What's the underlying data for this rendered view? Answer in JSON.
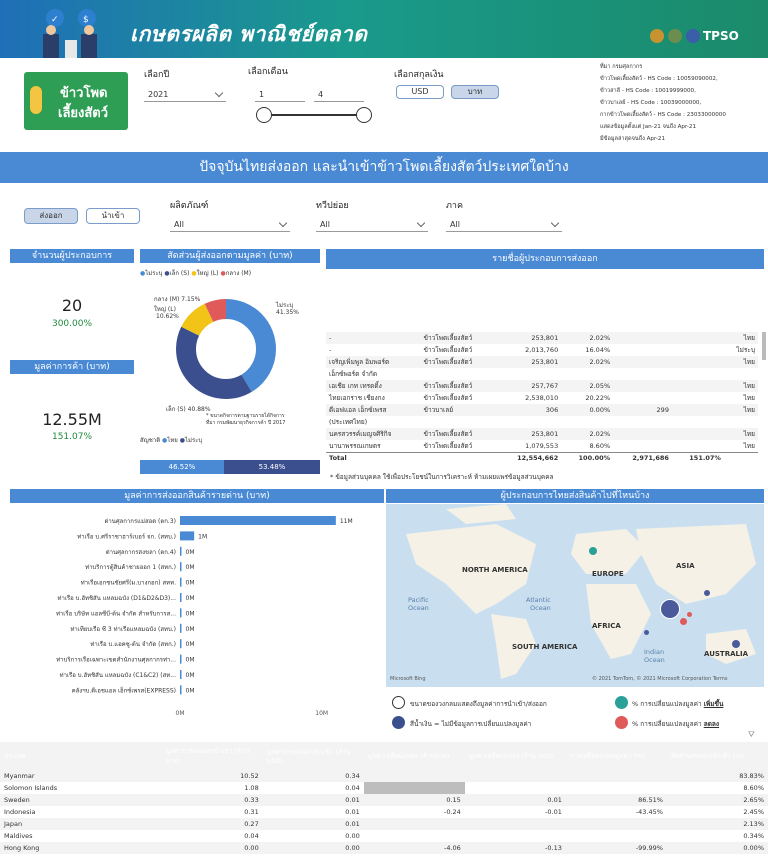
{
  "header": {
    "title": "เกษตรผลิต พาณิชย์ตลาด",
    "logo_text": "TPSO"
  },
  "product_badge": {
    "line1": "ข้าวโพด",
    "line2": "เลี้ยงสัตว์"
  },
  "filters": {
    "year_label": "เลือกปี",
    "year_value": "2021",
    "month_label": "เลือกเดือน",
    "month_from": "1",
    "month_to": "4",
    "currency_label": "เลือกสกุลเงิน",
    "currency_usd": "USD",
    "currency_thb": "บาท"
  },
  "source_info": [
    "ที่มา กรมศุลกากร",
    "ข้าวโพดเลี้ยงสัตว์ - HS Code : 10059090002,",
    "ข้าวสาลี - HS Code : 10019999000,",
    "ข้าวบาเลย์ - HS Code : 10039000000,",
    "กากข้าวโพดเลี้ยงสัตว์ - HS Code : 23033000000",
    "แสดงข้อมูลตั้งแต่ Jan-21 จนถึง Apr-21",
    "มีข้อมูลล่าสุดจนถึง Apr-21"
  ],
  "section_title": "ปัจจุบันไทยส่งออก และนำเข้าข้าวโพดเลี้ยงสัตว์ประเทศใดบ้าง",
  "toggle": {
    "export": "ส่งออก",
    "import": "นำเข้า"
  },
  "slicers": {
    "product_label": "ผลิตภัณฑ์",
    "product_value": "All",
    "continent_label": "ทวีปย่อย",
    "continent_value": "All",
    "region_label": "ภาค",
    "region_value": "All"
  },
  "cards": {
    "operators_title": "จำนวนผู้ประกอบการ",
    "operators_value": "20",
    "operators_change": "300.00%",
    "trade_title": "มูลค่าการค้า (บาท)",
    "trade_value": "12.55M",
    "trade_change": "151.07%"
  },
  "donut": {
    "title": "สัดส่วนผู้ส่งออกตามมูลค่า (บาท)",
    "legend": [
      "ไม่ระบุ",
      "เล็ก (S)",
      "ใหญ่ (L)",
      "กลาง (M)"
    ],
    "label_m": "กลาง (M) 7.15%",
    "label_l1": "ใหญ่ (L)",
    "label_l2": "10.62%",
    "label_na1": "ไม่ระบุ",
    "label_na2": "41.35%",
    "label_s": "เล็ก (S) 40.88%",
    "note1": "* ขนาดกิจการตามฐานรายได้กิจการ",
    "note2": "ที่มา กรมพัฒนาธุรกิจการค้า ปี 2017",
    "nat_label": "สัญชาติ",
    "nat_thai": "ไทย",
    "nat_na": "ไม่ระบุ",
    "bar_left": "46.52%",
    "bar_right": "53.48%"
  },
  "list_title": "รายชื่อผู้ประกอบการส่งออก",
  "operators": [
    [
      "-",
      "ข้าวโพดเลี้ยงสัตว์",
      "253,801",
      "2.02%",
      "",
      "",
      "ไทย"
    ],
    [
      "-",
      "ข้าวโพดเลี้ยงสัตว์",
      "2,013,760",
      "16.04%",
      "",
      "",
      "ไม่ระบุ"
    ],
    [
      "เจริญเพิ่มพูล อิมพอร์ต",
      "ข้าวโพดเลี้ยงสัตว์",
      "253,801",
      "2.02%",
      "",
      "",
      "ไทย"
    ],
    [
      "เอ็กซ์พอร์ต จำกัด",
      "",
      "",
      "",
      "",
      "",
      ""
    ],
    [
      "เอเชีย เกท เทรดดิ้ง",
      "ข้าวโพดเลี้ยงสัตว์",
      "257,767",
      "2.05%",
      "",
      "",
      "ไทย"
    ],
    [
      "ไทยเอกราช เชียงกง",
      "ข้าวโพดเลี้ยงสัตว์",
      "2,538,010",
      "20.22%",
      "",
      "",
      "ไทย"
    ],
    [
      "ดีเอฟแอล เอ็กซ์เพรส",
      "ข้าวบาเลย์",
      "306",
      "0.00%",
      "299",
      "",
      "ไทย"
    ],
    [
      "(ประเทศไทย)",
      "",
      "",
      "",
      "",
      "",
      ""
    ],
    [
      "นครสวรรค์เมญจศิริกิจ",
      "ข้าวโพดเลี้ยงสัตว์",
      "253,801",
      "2.02%",
      "",
      "",
      "ไทย"
    ],
    [
      "นานาพรรณเกษตร",
      "ข้าวโพดเลี้ยงสัตว์",
      "1,079,553",
      "8.60%",
      "",
      "",
      "ไทย"
    ]
  ],
  "operators_total": [
    "Total",
    "",
    "12,554,662",
    "100.00%",
    "2,971,686",
    "151.07%",
    ""
  ],
  "operators_note": "* ข้อมูลส่วนบุคคล ใช้เพื่อประโยชน์ในการวิเคราะห์ ห้ามเผยแพร่ข้อมูลส่วนบุคคล",
  "port_chart_title": "มูลค่าการส่งออกสินค้ารายด่าน (บาท)",
  "chart_data": {
    "type": "bar",
    "categories": [
      "ด่านศุลกากรแม่สอด (ตก.3)",
      "ท่าเรือ บ.ศรีราชาฮาร์เบอร์ จก. (สทบ.)",
      "ด่านศุลกากรสงขลา (ตก.4)",
      "ท่าบริการตู้สินค้าชายออก 1 (สทก.)",
      "ท่าเรือเอกชนชัยศรี(ม.บางกอก) สทท.",
      "ท่าเรือ บ.ฮัทชิสัน แหลมฉบัง (D1&D2&D3)...",
      "ท่าเรือ บริษัท แอลซีบี-ต้น จำกัด สำหรับการส...",
      "ท่าเทียบเรือ ซี 3 ท่าเรือแหลมฉบัง (สทบ.)",
      "ท่าเรือ บ.แอคซู-ต้น จำกัด (สทก.)",
      "ท่าบริการเรือเฉพาะเขตสำนักงานศุลกากรท่า...",
      "ท่าเรือ บ.ฮัทชิสัน แหลมฉบัง (C1&C2) (สท...",
      "คลังฯบ.ดีเอชแอล เอ็กซ์เพรส(EXPRESS)"
    ],
    "values": [
      11,
      1,
      0,
      0,
      0,
      0,
      0,
      0,
      0,
      0,
      0,
      0
    ],
    "value_labels": [
      "11M",
      "1M",
      "0M",
      "0M",
      "0M",
      "0M",
      "0M",
      "0M",
      "0M",
      "0M",
      "0M",
      "0M"
    ],
    "x_ticks": [
      "0M",
      "10M"
    ],
    "xlim": [
      0,
      12
    ]
  },
  "map": {
    "title": "ผู้ประกอบการไทยส่งสินค้าไปที่ไหนบ้าง",
    "labels": {
      "na": "NORTH AMERICA",
      "eu": "EUROPE",
      "asia": "ASIA",
      "pac": "Pacific",
      "pac2": "Ocean",
      "atl": "Atlantic",
      "atl2": "Ocean",
      "af": "AFRICA",
      "sa": "SOUTH AMERICA",
      "ind": "Indian",
      "ind2": "Ocean",
      "au": "AUSTRALIA"
    },
    "brand": "Microsoft Bing",
    "copyright": "© 2021 TomTom, © 2021 Microsoft Corporation Terms"
  },
  "legend": {
    "size": "ขนาดของวงกลมแสดงถึงมูลค่าการนำเข้า/ส่งออก",
    "blue": "สีน้ำเงิน = ไม่มีข้อมูลการเปลี่ยนแปลงมูลค่า",
    "teal": "% การเปลี่ยนแปลงมูลค่า",
    "teal_b": "เพิ่มขึ้น",
    "red": "% การเปลี่ยนแปลงมูลค่า",
    "red_b": "ลดลง"
  },
  "country_table": {
    "headers": [
      "ประเทศ",
      "มูลค่าการส่งออก/นำเข้า (ล้านบาท)",
      "มูลค่าการส่งออก/นำเข้า (ล้าน USD)",
      "มูลค่าเปลี่ยนแปลง (ล้านบาท)",
      "มูลค่าเปลี่ยนแปลง (ล้าน USD)",
      "การเปลี่ยนแปลงมูลค่า (%)",
      "สัดส่วนส่งออก/นำเข้า (%)"
    ],
    "rows": [
      [
        "Myanmar",
        "10.52",
        "0.34",
        "",
        "",
        "",
        "83.83%"
      ],
      [
        "Solomon Islands",
        "1.08",
        "0.04",
        "",
        "",
        "",
        "8.60%"
      ],
      [
        "Sweden",
        "0.33",
        "0.01",
        "0.15",
        "0.01",
        "86.51%",
        "2.65%"
      ],
      [
        "Indonesia",
        "0.31",
        "0.01",
        "-0.24",
        "-0.01",
        "-43.45%",
        "2.45%"
      ],
      [
        "Japan",
        "0.27",
        "0.01",
        "",
        "",
        "",
        "2.13%"
      ],
      [
        "Maldives",
        "0.04",
        "0.00",
        "",
        "",
        "",
        "0.34%"
      ],
      [
        "Hong Kong",
        "0.00",
        "0.00",
        "-4.06",
        "-0.13",
        "-99.99%",
        "0.00%"
      ]
    ]
  },
  "colors": {
    "blue": "#4a8ad4",
    "navy": "#3b4f8f",
    "yellow": "#f2c418",
    "red": "#e05a5a",
    "teal": "#2aa198"
  }
}
